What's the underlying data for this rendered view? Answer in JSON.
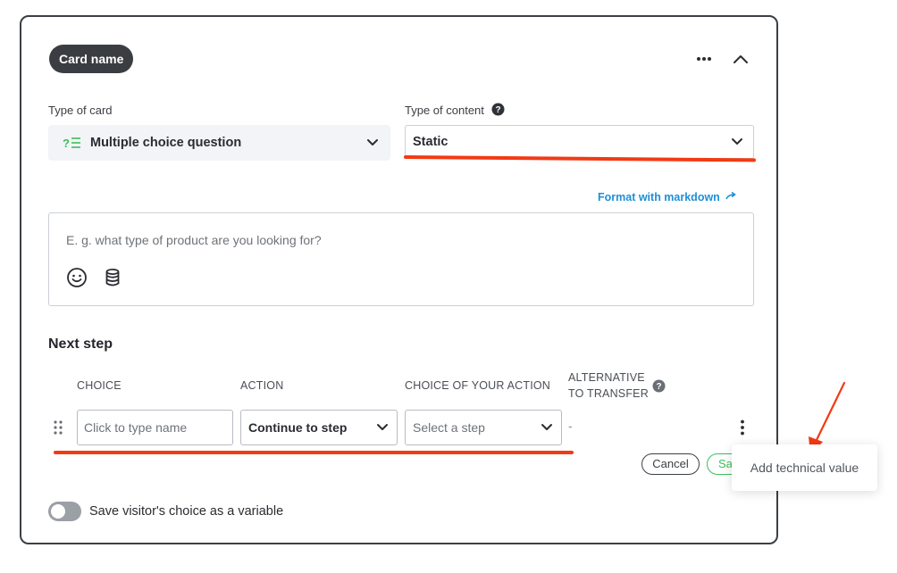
{
  "card": {
    "name": "Card name",
    "more_icon": "more-horizontal-icon",
    "collapse_icon": "chevron-up-icon"
  },
  "type_of_card": {
    "label": "Type of card",
    "value": "Multiple choice question",
    "icon": "multiple-choice-icon"
  },
  "type_of_content": {
    "label": "Type of content",
    "value": "Static",
    "help_icon": "question-circle-icon"
  },
  "markdown_link": "Format with markdown",
  "message": {
    "placeholder": "E. g. what type of product are you looking for?",
    "icons": [
      "emoji-icon",
      "database-icon"
    ]
  },
  "next_step": {
    "heading": "Next step",
    "columns": {
      "choice": "CHOICE",
      "action": "ACTION",
      "choice_of_action": "CHOICE OF YOUR ACTION",
      "alternative_line1": "ALTERNATIVE",
      "alternative_line2": "TO TRANSFER"
    },
    "row": {
      "choice_placeholder": "Click to type name",
      "action_value": "Continue to step",
      "step_placeholder": "Select a step",
      "alternative_value": "-"
    },
    "cancel_label": "Cancel",
    "save_label": "Sa"
  },
  "save_variable_label": "Save visitor's choice as a variable",
  "popup_menu": {
    "item": "Add technical value"
  },
  "colors": {
    "accent_red": "#f23a14",
    "link_blue": "#1f8fd6",
    "success_green": "#3bbf5a",
    "dark": "#3a3d42"
  }
}
